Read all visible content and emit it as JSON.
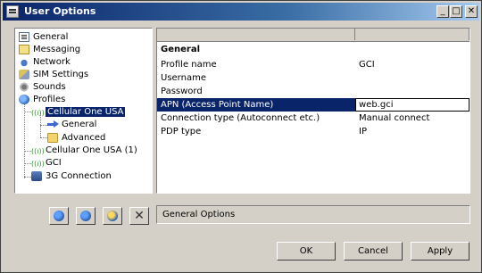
{
  "window": {
    "title": "User Options",
    "controls": {
      "minimize": "_",
      "maximize": "□",
      "close": "✕"
    }
  },
  "tree": {
    "items": [
      {
        "label": "General",
        "icon": "general-icon"
      },
      {
        "label": "Messaging",
        "icon": "envelope-icon"
      },
      {
        "label": "Network",
        "icon": "network-icon"
      },
      {
        "label": "SIM Settings",
        "icon": "sim-card-icon"
      },
      {
        "label": "Sounds",
        "icon": "speaker-icon"
      },
      {
        "label": "Profiles",
        "icon": "globe-icon"
      },
      {
        "label": "Cellular One USA",
        "icon": "antenna-icon",
        "selected": true
      },
      {
        "label": "General",
        "icon": "arrow-right-icon"
      },
      {
        "label": "Advanced",
        "icon": "folder-icon"
      },
      {
        "label": "Cellular One USA (1)",
        "icon": "antenna-icon"
      },
      {
        "label": "GCI",
        "icon": "antenna-icon"
      },
      {
        "label": "3G Connection",
        "icon": "phone-icon"
      }
    ]
  },
  "grid": {
    "section": "General",
    "rows": [
      {
        "key": "Profile name",
        "value": "GCI"
      },
      {
        "key": "Username",
        "value": ""
      },
      {
        "key": "Password",
        "value": ""
      },
      {
        "key": "APN (Access Point Name)",
        "value": "web.gci",
        "selected": true
      },
      {
        "key": "Connection type (Autoconnect etc.)",
        "value": "Manual connect"
      },
      {
        "key": "PDP type",
        "value": "IP"
      }
    ]
  },
  "status_text": "General Options",
  "buttons": {
    "ok": "OK",
    "cancel": "Cancel",
    "apply": "Apply"
  },
  "icons": [
    "add-profile-icon",
    "edit-profile-icon",
    "copy-profile-icon",
    "delete-icon"
  ],
  "colors": {
    "title_bar": "#0a246a",
    "selection": "#0a246a",
    "antenna": "#2e9a2e"
  }
}
